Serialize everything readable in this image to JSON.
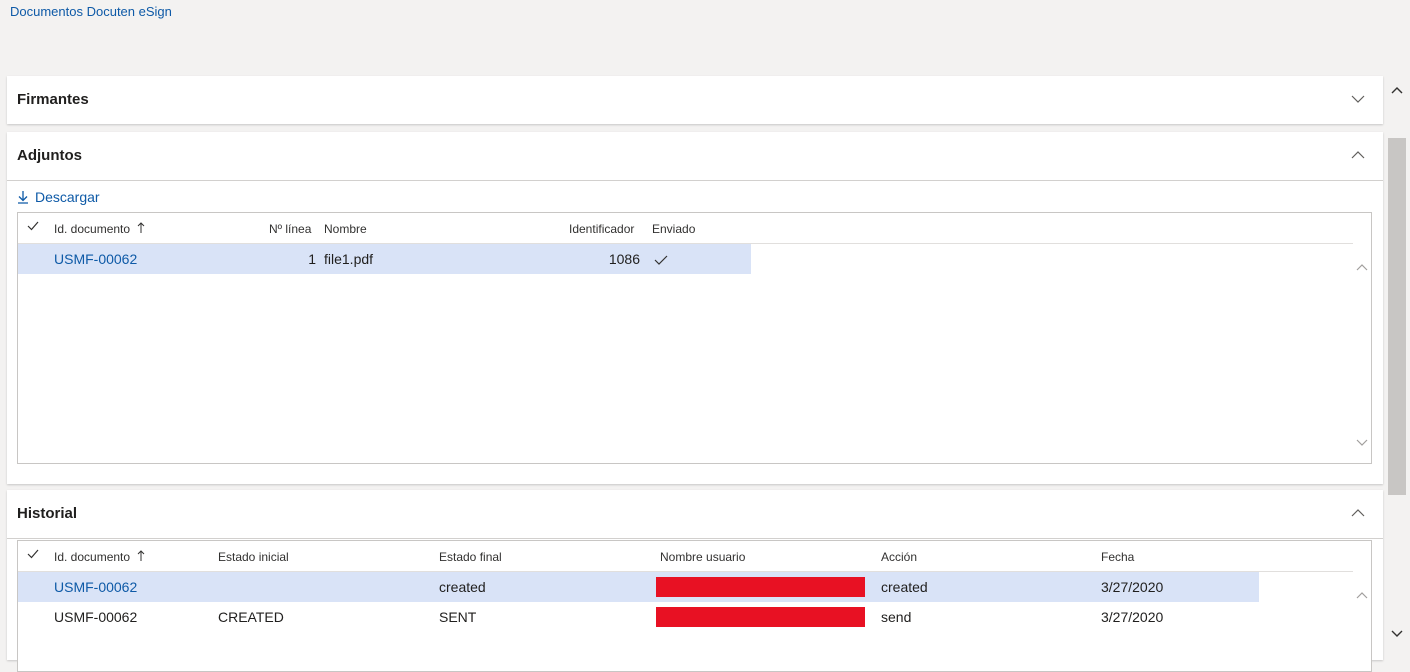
{
  "breadcrumb": "Documentos Docuten eSign",
  "sections": {
    "firmantes": {
      "title": "Firmantes"
    },
    "adjuntos": {
      "title": "Adjuntos",
      "download_label": "Descargar",
      "columns": {
        "id": "Id. documento",
        "linea": "Nº línea",
        "nombre": "Nombre",
        "identificador": "Identificador",
        "enviado": "Enviado"
      },
      "rows": [
        {
          "id": "USMF-00062",
          "linea": "1",
          "nombre": "file1.pdf",
          "identificador": "1086",
          "enviado": true
        }
      ]
    },
    "historial": {
      "title": "Historial",
      "columns": {
        "id": "Id. documento",
        "estado_inicial": "Estado inicial",
        "estado_final": "Estado final",
        "usuario": "Nombre usuario",
        "accion": "Acción",
        "fecha": "Fecha"
      },
      "rows": [
        {
          "id": "USMF-00062",
          "estado_inicial": "",
          "estado_final": "created",
          "accion": "created",
          "fecha": "3/27/2020"
        },
        {
          "id": "USMF-00062",
          "estado_inicial": "CREATED",
          "estado_final": "SENT",
          "accion": "send",
          "fecha": "3/27/2020"
        }
      ]
    }
  },
  "colors": {
    "link": "#0e5aa7",
    "selected_row": "#d9e3f7",
    "redaction": "#e81123"
  },
  "icons": [
    "download-icon",
    "check-icon",
    "sort-ascending-icon",
    "chevron-down-icon",
    "chevron-up-icon"
  ]
}
